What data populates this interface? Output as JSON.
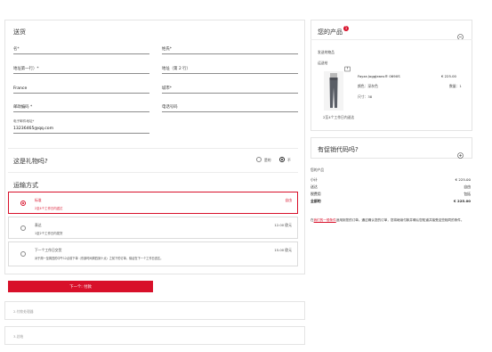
{
  "shipping": {
    "title": "送货",
    "fields": {
      "first_name": {
        "label": "名*",
        "value": ""
      },
      "last_name": {
        "label": "姓氏*",
        "value": ""
      },
      "address1": {
        "label": "地址第一行）*",
        "value": ""
      },
      "address2": {
        "label": "地址（第 2 行）",
        "value": ""
      },
      "country": {
        "label": "",
        "value": "France"
      },
      "city": {
        "label": "城市*",
        "value": ""
      },
      "postcode": {
        "label": "邮政编码 *",
        "value": ""
      },
      "phone": {
        "label": "电话号码",
        "value": ""
      },
      "email": {
        "label": "电子邮件地址*",
        "value": "13236465@qq.com"
      }
    }
  },
  "gift": {
    "question": "这是礼物吗?",
    "yes_label": "是的",
    "no_label": "不",
    "selected": "no"
  },
  "delivery": {
    "title": "运输方式",
    "options": [
      {
        "name": "标准",
        "note": "2至4个工作日内送达",
        "price": "自由",
        "selected": true
      },
      {
        "name": "表达",
        "note": "1至2个工作日内发货",
        "price": "12.00 欧元",
        "selected": false
      },
      {
        "name": "下一个工作日交货",
        "note": "对于周一至周四的中午12点前下单（东部时间周四到十点）之前下的订单，保证在下一个工作日送达。",
        "price": "15.00 欧元",
        "selected": false
      }
    ]
  },
  "next_button": "下一个: 付款",
  "collapsed_steps": [
    "2.付款处理器",
    "3.总结"
  ],
  "cart": {
    "title": "您的产品",
    "badge": "1",
    "collapse_icon": "minus-circle-icon",
    "section_label": "发送的物品",
    "ship_label": "运送给",
    "product": {
      "name": "Fayza JoggJeans® 069XS",
      "price": "€ 225.00",
      "color_label": "颜色：",
      "color_value": "深灰色",
      "qty_label": "数量：",
      "qty_value": "1",
      "size_label": "尺寸：",
      "size_value": "38",
      "image": "grey-jeans-icon"
    },
    "delivery_note": "2至4个工作日内送达"
  },
  "promo": {
    "title": "有促销代码吗?",
    "expand_icon": "plus-circle-icon"
  },
  "summary": {
    "label": "您的产品",
    "rows": [
      {
        "label": "小计",
        "value": "€ 225.00",
        "bold": false
      },
      {
        "label": "送达",
        "value": "自由",
        "bold": false
      },
      {
        "label": "税费用",
        "value": "包括",
        "bold": false
      },
      {
        "label": "全部的",
        "value": "€ 225.00",
        "bold": true
      }
    ],
    "terms_prefix": "在",
    "terms_link": "我们的一般条件",
    "terms_suffix": "适用到您的订单。通过确认您的订单，您将继续付款并确认您知道并接受这些相同的条件。"
  },
  "colors": {
    "accent": "#d8102a",
    "border": "#e4e4e4"
  }
}
